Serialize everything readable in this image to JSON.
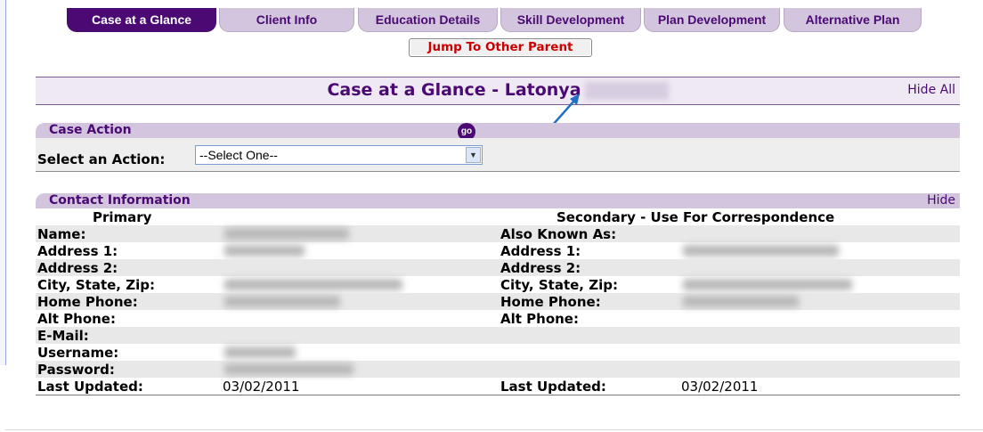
{
  "tabs": [
    {
      "label": "Case at a Glance",
      "active": true
    },
    {
      "label": "Client Info",
      "active": false
    },
    {
      "label": "Education Details",
      "active": false
    },
    {
      "label": "Skill Development",
      "active": false
    },
    {
      "label": "Plan Development",
      "active": false
    },
    {
      "label": "Alternative Plan",
      "active": false
    }
  ],
  "jump_button": "Jump To Other Parent",
  "title": {
    "text": "Case at a Glance - Latonya",
    "hide_all": "Hide All"
  },
  "case_action": {
    "header": "Case Action",
    "label": "Select an Action:",
    "select_value": "--Select One--",
    "go_label": "go"
  },
  "contact": {
    "header": "Contact Information",
    "hide": "Hide",
    "primary_header": "Primary",
    "secondary_header": "Secondary - Use For Correspondence",
    "rows": [
      {
        "l1": "Name:",
        "v1": "",
        "l2": "Also Known As:",
        "v2": ""
      },
      {
        "l1": "Address 1:",
        "v1": "",
        "l2": "Address 1:",
        "v2": ""
      },
      {
        "l1": "Address 2:",
        "v1": "",
        "l2": "Address 2:",
        "v2": ""
      },
      {
        "l1": "City, State, Zip:",
        "v1": "",
        "l2": "City, State, Zip:",
        "v2": ""
      },
      {
        "l1": "Home Phone:",
        "v1": "",
        "l2": "Home Phone:",
        "v2": ""
      },
      {
        "l1": "Alt Phone:",
        "v1": "",
        "l2": "Alt Phone:",
        "v2": ""
      },
      {
        "l1": "E-Mail:",
        "v1": "",
        "l2": "",
        "v2": ""
      },
      {
        "l1": "Username:",
        "v1": "",
        "l2": "",
        "v2": ""
      },
      {
        "l1": "Password:",
        "v1": "",
        "l2": "",
        "v2": ""
      },
      {
        "l1": "Last Updated:",
        "v1": "03/02/2011",
        "l2": "Last Updated:",
        "v2": "03/02/2011"
      }
    ]
  },
  "colors": {
    "brand_purple": "#4b0a73",
    "tab_inactive": "#d3c5dd",
    "jump_red": "#cc0000",
    "annotation_arrow": "#1f6fc4"
  }
}
